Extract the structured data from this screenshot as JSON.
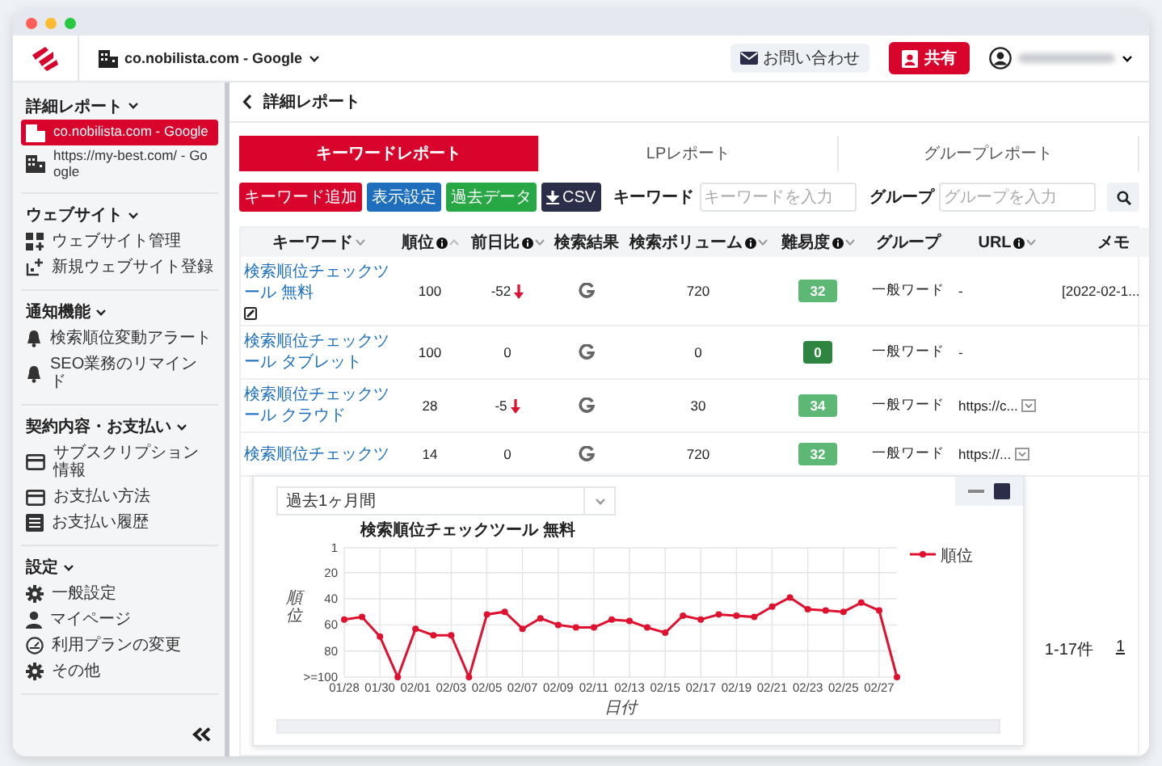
{
  "header": {
    "site_selector": "co.nobilista.com - Google",
    "contact_button": "お問い合わせ",
    "share_button": "共有"
  },
  "sidebar": {
    "sections": [
      {
        "title": "詳細レポート",
        "items": [
          {
            "kind": "site",
            "label": "co.nobilista.com - Google",
            "selected": true
          },
          {
            "kind": "site",
            "label": "https://my-best.com/ - Google",
            "selected": false
          }
        ]
      },
      {
        "title": "ウェブサイト",
        "items": [
          {
            "kind": "grid",
            "label": "ウェブサイト管理",
            "selected": false
          },
          {
            "kind": "add",
            "label": "新規ウェブサイト登録",
            "selected": false
          }
        ]
      },
      {
        "title": "通知機能",
        "items": [
          {
            "kind": "bell",
            "label": "検索順位変動アラート",
            "selected": false
          },
          {
            "kind": "bell",
            "label": "SEO業務のリマインド",
            "selected": false
          }
        ]
      },
      {
        "title": "契約内容・お支払い",
        "items": [
          {
            "kind": "card",
            "label": "サブスクリプション情報",
            "selected": false
          },
          {
            "kind": "card",
            "label": "お支払い方法",
            "selected": false
          },
          {
            "kind": "list",
            "label": "お支払い履歴",
            "selected": false
          }
        ]
      },
      {
        "title": "設定",
        "items": [
          {
            "kind": "gear",
            "label": "一般設定",
            "selected": false
          },
          {
            "kind": "person",
            "label": "マイページ",
            "selected": false
          },
          {
            "kind": "gauge",
            "label": "利用プランの変更",
            "selected": false
          },
          {
            "kind": "gear",
            "label": "その他",
            "selected": false
          }
        ]
      }
    ]
  },
  "page_title": "詳細レポート",
  "tabs": [
    {
      "label": "キーワードレポート",
      "selected": true
    },
    {
      "label": "LPレポート",
      "selected": false
    },
    {
      "label": "グループレポート",
      "selected": false
    }
  ],
  "actions": [
    {
      "kind": "plain",
      "label": "キーワード追加",
      "color": "#d9042b"
    },
    {
      "kind": "plain",
      "label": "表示設定",
      "color": "#1d6fbd"
    },
    {
      "kind": "plain",
      "label": "過去データ",
      "color": "#28a745"
    },
    {
      "kind": "download",
      "label": "CSV",
      "color": "#2b2e48"
    }
  ],
  "filters": [
    {
      "label": "キーワード",
      "placeholder": "キーワードを入力"
    },
    {
      "label": "グループ",
      "placeholder": "グループを入力"
    }
  ],
  "table": {
    "columns": [
      {
        "label": "キーワード",
        "info": false,
        "sortable": true,
        "ascending": false
      },
      {
        "label": "順位",
        "info": true,
        "sortable": true,
        "ascending": true
      },
      {
        "label": "前日比",
        "info": true,
        "sortable": true,
        "ascending": false
      },
      {
        "label": "検索結果",
        "info": false,
        "sortable": false
      },
      {
        "label": "検索ボリューム",
        "info": true,
        "sortable": true,
        "ascending": false
      },
      {
        "label": "難易度",
        "info": true,
        "sortable": true,
        "ascending": false
      },
      {
        "label": "グループ",
        "info": false,
        "sortable": false
      },
      {
        "label": "URL",
        "info": true,
        "sortable": true,
        "ascending": false
      },
      {
        "label": "メモ",
        "info": false,
        "sortable": false
      }
    ],
    "rows": [
      {
        "keyword": "検索順位チェックツール 無料",
        "edit": true,
        "rank": "100",
        "change": "-52",
        "falling": true,
        "volume": "720",
        "difficulty": "32",
        "color": "#5cb874",
        "group": "一般ワード",
        "url": "-",
        "url_menu": false,
        "memo": "[2022-02-1..."
      },
      {
        "keyword": "検索順位チェックツール タブレット",
        "edit": false,
        "rank": "100",
        "change": "0",
        "falling": false,
        "volume": "0",
        "difficulty": "0",
        "color": "#2e8540",
        "group": "一般ワード",
        "url": "-",
        "url_menu": false
      },
      {
        "keyword": "検索順位チェックツール クラウド",
        "edit": false,
        "rank": "28",
        "change": "-5",
        "falling": true,
        "volume": "30",
        "difficulty": "34",
        "color": "#5cb874",
        "group": "一般ワード",
        "url": "https://c...",
        "url_menu": true
      },
      {
        "keyword": "検索順位チェックツ",
        "edit": false,
        "rank": "14",
        "change": "0",
        "falling": false,
        "volume": "720",
        "difficulty": "32",
        "color": "#5cb874",
        "group": "一般ワード",
        "url": "https://...",
        "url_menu": true
      }
    ]
  },
  "pagination": {
    "range": "1-17件",
    "page": "1"
  },
  "chart_panel": {
    "period": "過去1ヶ月間",
    "chart_data": {
      "type": "line",
      "title": "検索順位チェックツール 無料",
      "xlabel": "日付",
      "ylabel": "順位",
      "categories": [
        "01/28",
        null,
        "01/30",
        null,
        "02/01",
        null,
        "02/03",
        null,
        "02/05",
        null,
        "02/07",
        null,
        "02/09",
        null,
        "02/11",
        null,
        "02/13",
        null,
        "02/15",
        null,
        "02/17",
        null,
        "02/19",
        null,
        "02/21",
        null,
        "02/23",
        null,
        "02/25",
        null,
        "02/27",
        null
      ],
      "grid": true,
      "series": [
        {
          "name": "順位",
          "color": "#e0102f",
          "marker": true,
          "values": [
            56,
            54,
            69,
            100,
            63,
            68,
            68,
            100,
            52,
            50,
            63,
            55,
            60,
            62,
            62,
            56,
            57,
            62,
            66,
            53,
            56,
            52,
            53,
            54,
            46,
            39,
            48,
            49,
            50,
            43,
            49,
            100
          ]
        }
      ],
      "ylim": [
        100,
        1
      ],
      "yticks": [
        1,
        20,
        40,
        60,
        80,
        {
          "value": 100,
          "label": ">=100"
        }
      ]
    }
  }
}
